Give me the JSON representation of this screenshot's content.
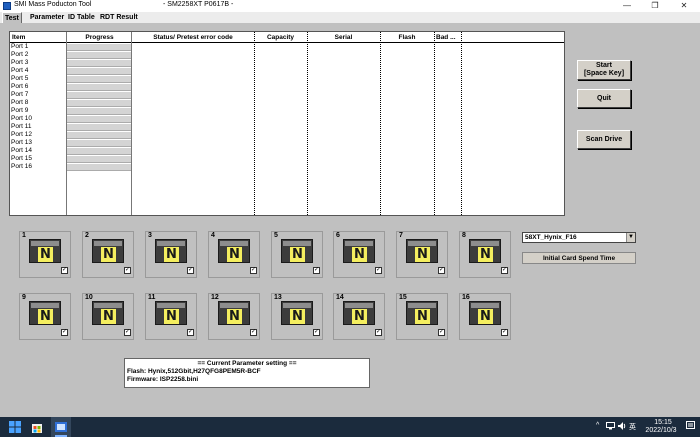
{
  "window": {
    "title": "SMI Mass Poducton Tool",
    "subtitle": "- SM2258XT    P0617B -",
    "controls": {
      "minimize": "—",
      "restore": "❐",
      "close": "✕"
    }
  },
  "tabs": [
    {
      "label": "Test",
      "active": true
    },
    {
      "label": "Parameter"
    },
    {
      "label": "ID Table"
    },
    {
      "label": "RDT Result"
    }
  ],
  "grid": {
    "columns": [
      "Item",
      "Progress",
      "Status/ Pretest error code",
      "Capacity",
      "Serial",
      "Flash",
      "Bad ..."
    ],
    "ports": [
      "Port 1",
      "Port 2",
      "Port 3",
      "Port 4",
      "Port 5",
      "Port 6",
      "Port 7",
      "Port 8",
      "Port 9",
      "Port 10",
      "Port 11",
      "Port 12",
      "Port 13",
      "Port 14",
      "Port 15",
      "Port 16"
    ]
  },
  "buttons": {
    "start": "Start\n[Space Key]",
    "quit": "Quit",
    "scan": "Scan Drive"
  },
  "drives": {
    "letter": "N",
    "check": "✓",
    "numbers": [
      "1",
      "2",
      "3",
      "4",
      "5",
      "6",
      "7",
      "8",
      "9",
      "10",
      "11",
      "12",
      "13",
      "14",
      "15",
      "16"
    ]
  },
  "setting": {
    "selected": "58XT_Hynix_F16",
    "spend_label": "Initial Card Spend Time"
  },
  "parameter": {
    "title": "== Current Parameter setting ==",
    "flash": "Flash:   Hynix,512Gbit,H27QFG8PEM5R-BCF",
    "firmware": "Firmware:   ISP2258.bini"
  },
  "taskbar": {
    "tray_chevron": "^",
    "tray_lang": "英",
    "time": "15:15",
    "date": "2022/10/3"
  },
  "colors": {
    "background": "#c0c0c0",
    "taskbar": "#1b2b3d",
    "drive_label": "#f4ee5f"
  }
}
